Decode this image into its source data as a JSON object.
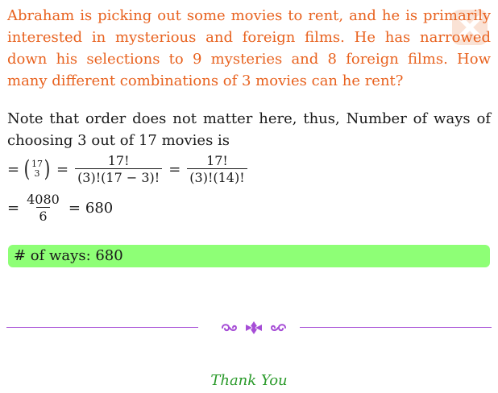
{
  "question": {
    "text": "Abraham is picking out some movies to rent, and he is primarily interested in mysterious and foreign films. He has narrowed down his selections to 9 mysteries and 8 foreign films. How many different combinations of 3 movies can he rent?",
    "color": "#e8621f"
  },
  "solution": {
    "intro": "Note that order does not matter here, thus, Number of ways of choosing 3 out of 17 movies is",
    "step1": {
      "equals1": "=",
      "binom_top": "17",
      "binom_bottom": "3",
      "equals2": "=",
      "frac1_num": "17!",
      "frac1_den": "(3)!(17 − 3)!",
      "equals3": "=",
      "frac2_num": "17!",
      "frac2_den": "(3)!(14)!"
    },
    "step2": {
      "equals1": "=",
      "frac_num": "4080",
      "frac_den": "6",
      "equals2": "=",
      "result": "680"
    }
  },
  "answer": {
    "text": "# of ways: 680",
    "background": "#8eff76"
  },
  "divider": {
    "ornament_icon": "floral-ornament-icon",
    "color": "#a64dd6"
  },
  "footer": {
    "thanks": "Thank You",
    "color": "#2a9a2a"
  }
}
